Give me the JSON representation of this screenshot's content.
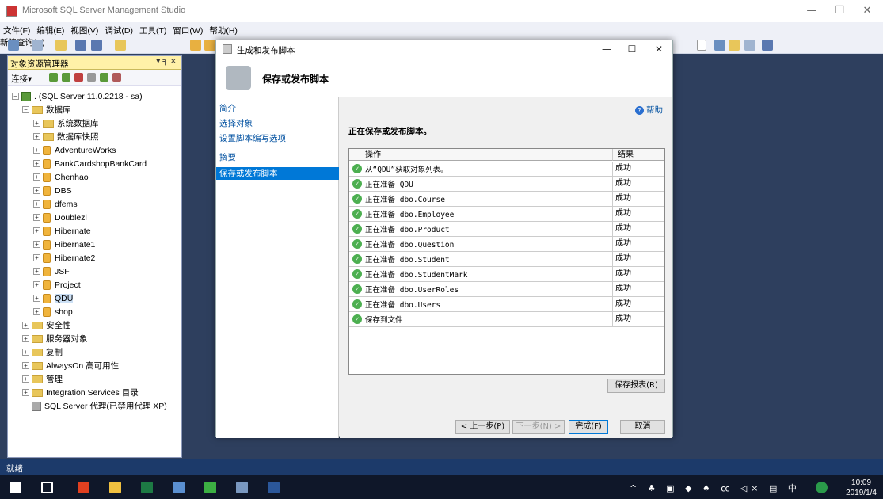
{
  "app": {
    "title": "Microsoft SQL Server Management Studio"
  },
  "menu": [
    "文件(F)",
    "编辑(E)",
    "视图(V)",
    "调试(D)",
    "工具(T)",
    "窗口(W)",
    "帮助(H)"
  ],
  "toolbar": {
    "new_query": "新建查询(N)"
  },
  "object_explorer": {
    "title": "对象资源管理器",
    "pin": "▾ ╕ ×",
    "connect": "连接▾",
    "server": ". (SQL Server 11.0.2218 - sa)",
    "databases_label": "数据库",
    "items": [
      "系统数据库",
      "数据库快照",
      "AdventureWorks",
      "BankCardshopBankCard",
      "Chenhao",
      "DBS",
      "dfems",
      "Doublezl",
      "Hibernate",
      "Hibernate1",
      "Hibernate2",
      "JSF",
      "Project",
      "QDU",
      "shop"
    ],
    "top_items": [
      "安全性",
      "服务器对象",
      "复制",
      "AlwaysOn 高可用性",
      "管理",
      "Integration Services 目录"
    ],
    "agent": "SQL Server 代理(已禁用代理 XP)"
  },
  "dialog": {
    "title": "生成和发布脚本",
    "heading": "保存或发布脚本",
    "nav": [
      "简介",
      "选择对象",
      "设置脚本编写选项",
      "摘要",
      "保存或发布脚本"
    ],
    "help": "帮助",
    "progress": "正在保存或发布脚本。",
    "col_action": "操作",
    "col_result": "结果",
    "rows": [
      {
        "action": "从“QDU”获取对象列表。",
        "result": "成功"
      },
      {
        "action": "正在准备 QDU",
        "result": "成功"
      },
      {
        "action": "正在准备 dbo.Course",
        "result": "成功"
      },
      {
        "action": "正在准备 dbo.Employee",
        "result": "成功"
      },
      {
        "action": "正在准备 dbo.Product",
        "result": "成功"
      },
      {
        "action": "正在准备 dbo.Question",
        "result": "成功"
      },
      {
        "action": "正在准备 dbo.Student",
        "result": "成功"
      },
      {
        "action": "正在准备 dbo.StudentMark",
        "result": "成功"
      },
      {
        "action": "正在准备 dbo.UserRoles",
        "result": "成功"
      },
      {
        "action": "正在准备 dbo.Users",
        "result": "成功"
      },
      {
        "action": "保存到文件",
        "result": "成功"
      }
    ],
    "save_report": "保存报表(R)",
    "prev": "< 上一步(P)",
    "next": "下一步(N) >",
    "finish": "完成(F)",
    "cancel": "取消"
  },
  "status": "就绪",
  "clock": {
    "time": "10:09",
    "date": "2019/1/4"
  },
  "tray": "^ ♣ ▣ ◆ ♠ ㏄ ◁× ▤ 中"
}
